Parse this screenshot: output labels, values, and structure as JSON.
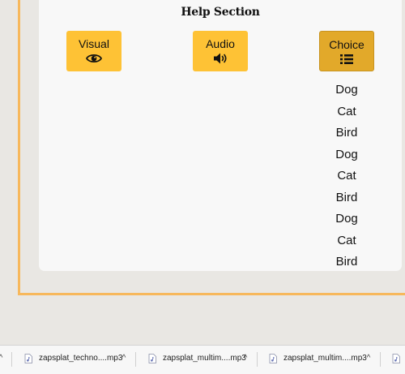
{
  "help_section": {
    "title": "Help Section",
    "buttons": {
      "visual": "Visual",
      "audio": "Audio",
      "choice": "Choice"
    },
    "active_button": "choice",
    "choices": [
      "Dog",
      "Cat",
      "Bird",
      "Dog",
      "Cat",
      "Bird",
      "Dog",
      "Cat",
      "Bird"
    ]
  },
  "downloads": {
    "items": [
      {
        "name": "zapsplat_techno....mp3"
      },
      {
        "name": "zapsplat_multim....mp3"
      },
      {
        "name": "zapsplat_multim....mp3"
      }
    ]
  },
  "colors": {
    "button": "#fec235",
    "button_active": "#e2a92a",
    "frame": "#f7b85c",
    "page_bg": "#e9e7e3"
  },
  "icons": {
    "visual": "eye-icon",
    "audio": "speaker-icon",
    "choice": "list-icon",
    "download_file": "audio-file-icon",
    "download_menu": "chevron-up-icon"
  }
}
